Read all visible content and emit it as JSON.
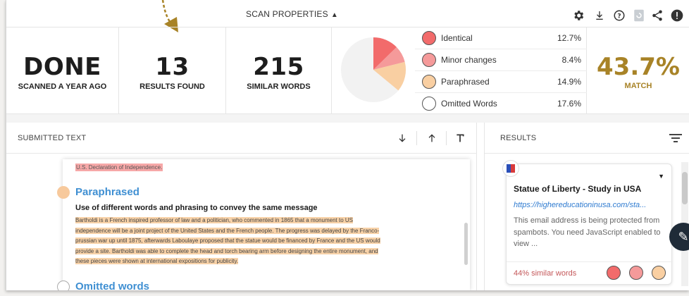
{
  "toolbar": {
    "scan_properties": "SCAN PROPERTIES",
    "icons": [
      "gear-icon",
      "download-icon",
      "help-icon",
      "refresh-icon",
      "share-icon",
      "alert-icon"
    ]
  },
  "stats": {
    "status": {
      "value": "DONE",
      "label": "SCANNED A YEAR AGO"
    },
    "results": {
      "value": "13",
      "label": "RESULTS FOUND"
    },
    "similar": {
      "value": "215",
      "label": "SIMILAR WORDS"
    }
  },
  "legend": [
    {
      "label": "Identical",
      "pct": "12.7%",
      "color": "#f26b6b"
    },
    {
      "label": "Minor changes",
      "pct": "8.4%",
      "color": "#f59a9a"
    },
    {
      "label": "Paraphrased",
      "pct": "14.9%",
      "color": "#f9cfa2"
    },
    {
      "label": "Omitted Words",
      "pct": "17.6%",
      "color": "#ffffff"
    }
  ],
  "match": {
    "value": "43.7%",
    "label": "MATCH",
    "color": "#a88327"
  },
  "submitted": {
    "title": "SUBMITTED TEXT",
    "declaration_fragment": "U.S. Declaration of Independence.",
    "section_title": "Paraphrased",
    "section_subtitle": "Use of different words and phrasing to convey the same message",
    "body_lines": [
      "Bartholdi is a French inspired professor of law and a politician, who commented in 1865 that a monument to US",
      "independence will be a joint project of the United States and the French people. The progress was delayed by the Franco-",
      "prussian war up until 1875, afterwards Laboulaye proposed that the statue would be financed by France and the US would",
      "provide a site. Bartholdi was able to complete the head and torch bearing arm before designing the entire monument, and",
      "these pieces were shown at international expositions for publicity."
    ],
    "next_section_title": "Omitted words"
  },
  "results": {
    "title": "RESULTS",
    "card": {
      "title": "Statue of Liberty - Study in USA",
      "url": "https://highereducationinusa.com/sta...",
      "body": "This email address is being protected from spambots. You need JavaScript enabled to view ...",
      "similar": "44% similar words"
    }
  }
}
